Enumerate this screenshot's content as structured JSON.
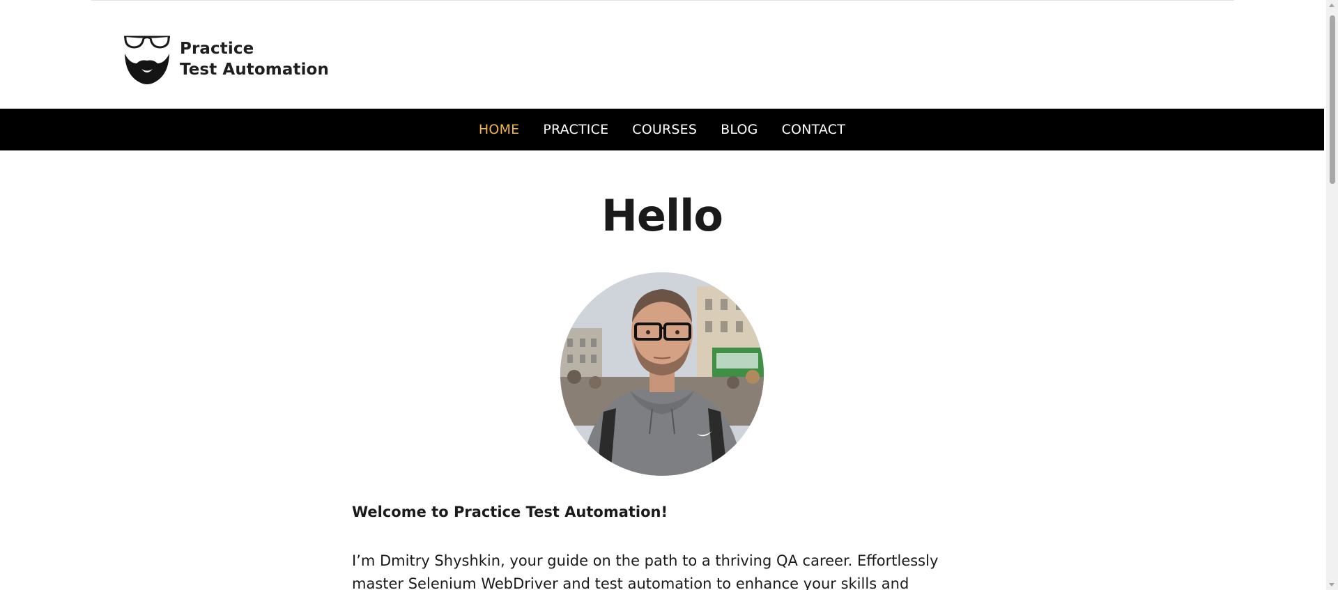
{
  "header": {
    "logo": {
      "line1": "Practice",
      "line2": "Test Automation"
    }
  },
  "nav": {
    "items": [
      {
        "label": "HOME",
        "active": true
      },
      {
        "label": "PRACTICE",
        "active": false
      },
      {
        "label": "COURSES",
        "active": false
      },
      {
        "label": "BLOG",
        "active": false
      },
      {
        "label": "CONTACT",
        "active": false
      }
    ]
  },
  "main": {
    "title": "Hello",
    "welcome": "Welcome to Practice Test Automation!",
    "intro": "I’m Dmitry Shyshkin, your guide on the path to a thriving QA career. Effortlessly master Selenium WebDriver and test automation to enhance your skills and increase your"
  },
  "colors": {
    "nav_background": "#000000",
    "nav_text": "#ffffff",
    "nav_active": "#f0b44c",
    "text": "#1a1a1a"
  },
  "icons": {
    "logo": "glasses-beard-logo-icon",
    "avatar": "profile-photo"
  }
}
